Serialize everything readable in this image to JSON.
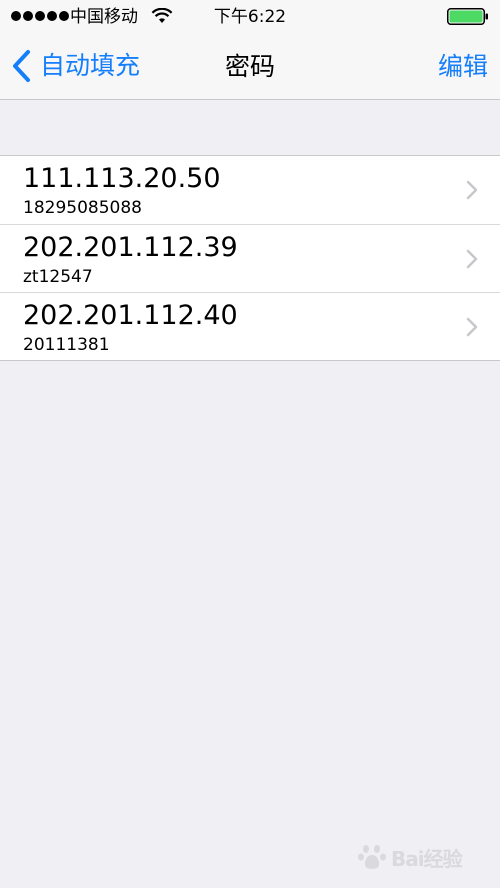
{
  "status_bar": {
    "carrier": "中国移动",
    "time": "下午6:22",
    "signal_bars": 5,
    "battery_level": 1.0,
    "battery_color": "#4cd964"
  },
  "nav": {
    "back_label": "自动填充",
    "title": "密码",
    "edit_label": "编辑",
    "accent_color": "#157efb"
  },
  "passwords": [
    {
      "site": "111.113.20.50",
      "account": "18295085088"
    },
    {
      "site": "202.201.112.39",
      "account": "zt12547"
    },
    {
      "site": "202.201.112.40",
      "account": "20111381"
    }
  ],
  "watermark": {
    "text": "Bai经验",
    "icon": "baidu-paw-icon"
  }
}
